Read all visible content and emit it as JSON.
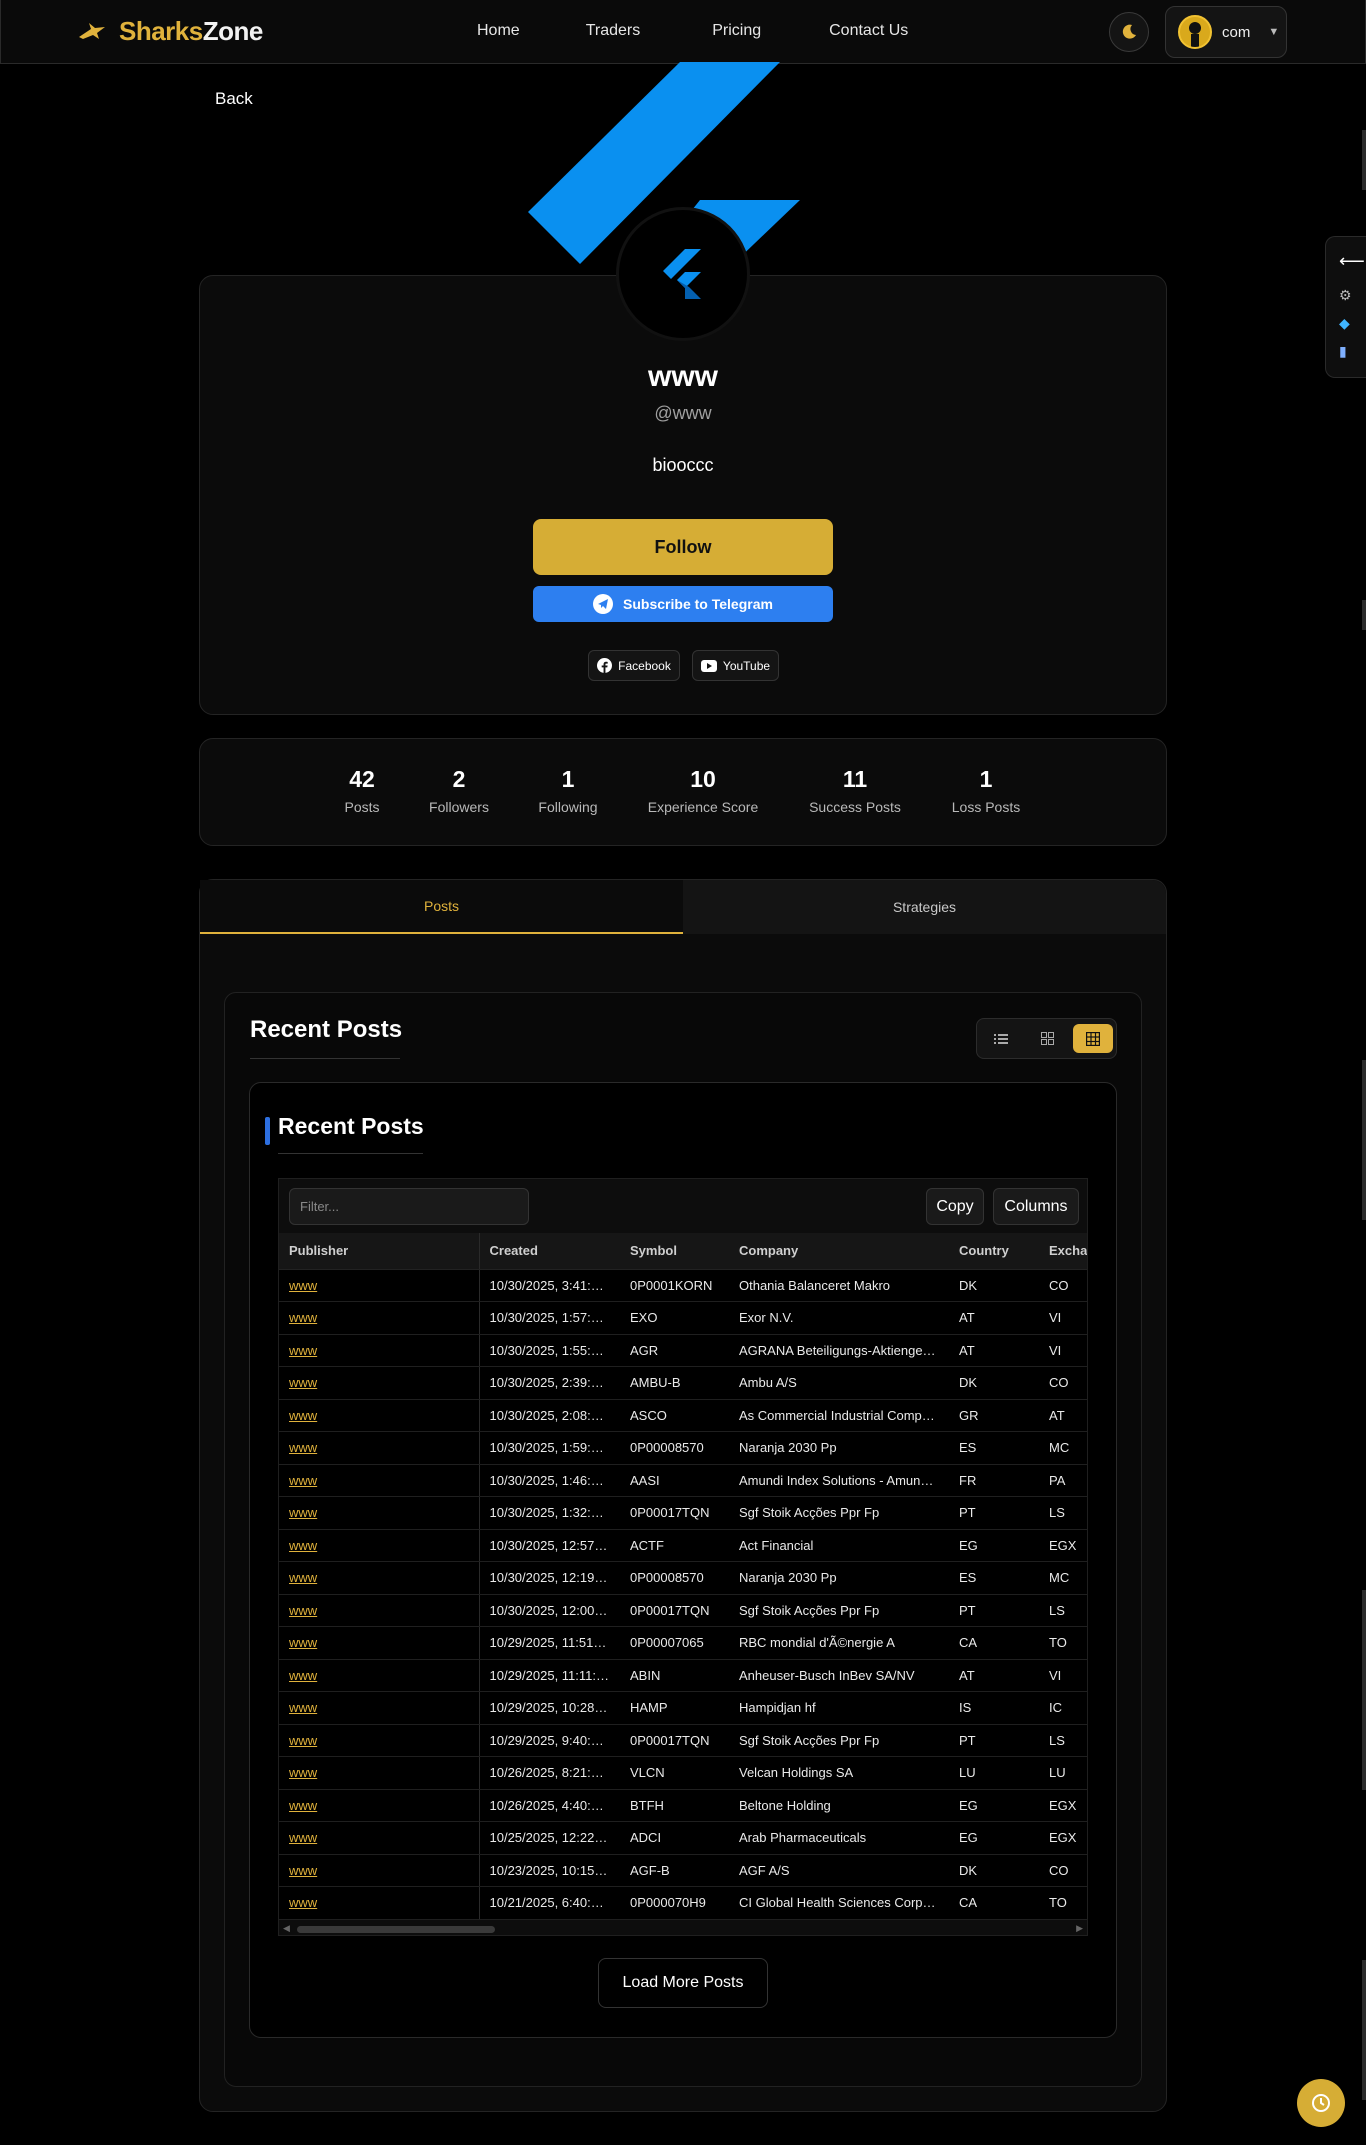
{
  "brand": {
    "part1": "Sharks",
    "part2": "Zone"
  },
  "nav": {
    "items": [
      {
        "label": "Home"
      },
      {
        "label": "Traders"
      },
      {
        "label": "Pricing"
      },
      {
        "label": "Contact Us"
      }
    ]
  },
  "user": {
    "name": "com"
  },
  "back_label": "Back",
  "profile": {
    "name": "www",
    "handle": "@www",
    "bio": "biooccc",
    "follow_label": "Follow",
    "telegram_label": "Subscribe to Telegram",
    "socials": [
      {
        "label": "Facebook",
        "icon": "facebook-icon"
      },
      {
        "label": "YouTube",
        "icon": "youtube-icon"
      }
    ]
  },
  "stats": [
    {
      "value": "42",
      "label": "Posts"
    },
    {
      "value": "2",
      "label": "Followers"
    },
    {
      "value": "1",
      "label": "Following"
    },
    {
      "value": "10",
      "label": "Experience Score"
    },
    {
      "value": "11",
      "label": "Success Posts"
    },
    {
      "value": "1",
      "label": "Loss Posts"
    }
  ],
  "tabs": [
    {
      "label": "Posts",
      "active": true
    },
    {
      "label": "Strategies",
      "active": false
    }
  ],
  "recent": {
    "section_title": "Recent Posts",
    "box_title": "Recent Posts",
    "filter_placeholder": "Filter...",
    "copy_label": "Copy",
    "columns_label": "Columns",
    "load_more_label": "Load More Posts",
    "headers": [
      "Publisher",
      "Created",
      "Symbol",
      "Company",
      "Country",
      "Excha"
    ],
    "rows": [
      [
        "www",
        "10/30/2025, 3:41:…",
        "0P0001KORN",
        "Othania Balanceret Makro",
        "DK",
        "CO"
      ],
      [
        "www",
        "10/30/2025, 1:57:…",
        "EXO",
        "Exor N.V.",
        "AT",
        "VI"
      ],
      [
        "www",
        "10/30/2025, 1:55:…",
        "AGR",
        "AGRANA Beteiligungs-Aktienge…",
        "AT",
        "VI"
      ],
      [
        "www",
        "10/30/2025, 2:39:…",
        "AMBU-B",
        "Ambu A/S",
        "DK",
        "CO"
      ],
      [
        "www",
        "10/30/2025, 2:08:…",
        "ASCO",
        "As Commercial Industrial Comp…",
        "GR",
        "AT"
      ],
      [
        "www",
        "10/30/2025, 1:59:…",
        "0P00008570",
        "Naranja 2030 Pp",
        "ES",
        "MC"
      ],
      [
        "www",
        "10/30/2025, 1:46:…",
        "AASI",
        "Amundi Index Solutions - Amun…",
        "FR",
        "PA"
      ],
      [
        "www",
        "10/30/2025, 1:32:…",
        "0P00017TQN",
        "Sgf Stoik Acções Ppr Fp",
        "PT",
        "LS"
      ],
      [
        "www",
        "10/30/2025, 12:57…",
        "ACTF",
        "Act Financial",
        "EG",
        "EGX"
      ],
      [
        "www",
        "10/30/2025, 12:19…",
        "0P00008570",
        "Naranja 2030 Pp",
        "ES",
        "MC"
      ],
      [
        "www",
        "10/30/2025, 12:00…",
        "0P00017TQN",
        "Sgf Stoik Acções Ppr Fp",
        "PT",
        "LS"
      ],
      [
        "www",
        "10/29/2025, 11:51…",
        "0P00007065",
        "RBC mondial d'Ã©nergie A",
        "CA",
        "TO"
      ],
      [
        "www",
        "10/29/2025, 11:11:…",
        "ABIN",
        "Anheuser-Busch InBev SA/NV",
        "AT",
        "VI"
      ],
      [
        "www",
        "10/29/2025, 10:28…",
        "HAMP",
        "Hampidjan hf",
        "IS",
        "IC"
      ],
      [
        "www",
        "10/29/2025, 9:40:…",
        "0P00017TQN",
        "Sgf Stoik Acções Ppr Fp",
        "PT",
        "LS"
      ],
      [
        "www",
        "10/26/2025, 8:21:…",
        "VLCN",
        "Velcan Holdings SA",
        "LU",
        "LU"
      ],
      [
        "www",
        "10/26/2025, 4:40:…",
        "BTFH",
        "Beltone Holding",
        "EG",
        "EGX"
      ],
      [
        "www",
        "10/25/2025, 12:22…",
        "ADCI",
        "Arab Pharmaceuticals",
        "EG",
        "EGX"
      ],
      [
        "www",
        "10/23/2025, 10:15…",
        "AGF-B",
        "AGF A/S",
        "DK",
        "CO"
      ],
      [
        "www",
        "10/21/2025, 6:40:…",
        "0P000070H9",
        "CI Global Health Sciences Corp…",
        "CA",
        "TO"
      ]
    ]
  },
  "colors": {
    "accent": "#e0b23c",
    "telegram": "#2d7ff0",
    "flutter": "#0a90f0"
  }
}
